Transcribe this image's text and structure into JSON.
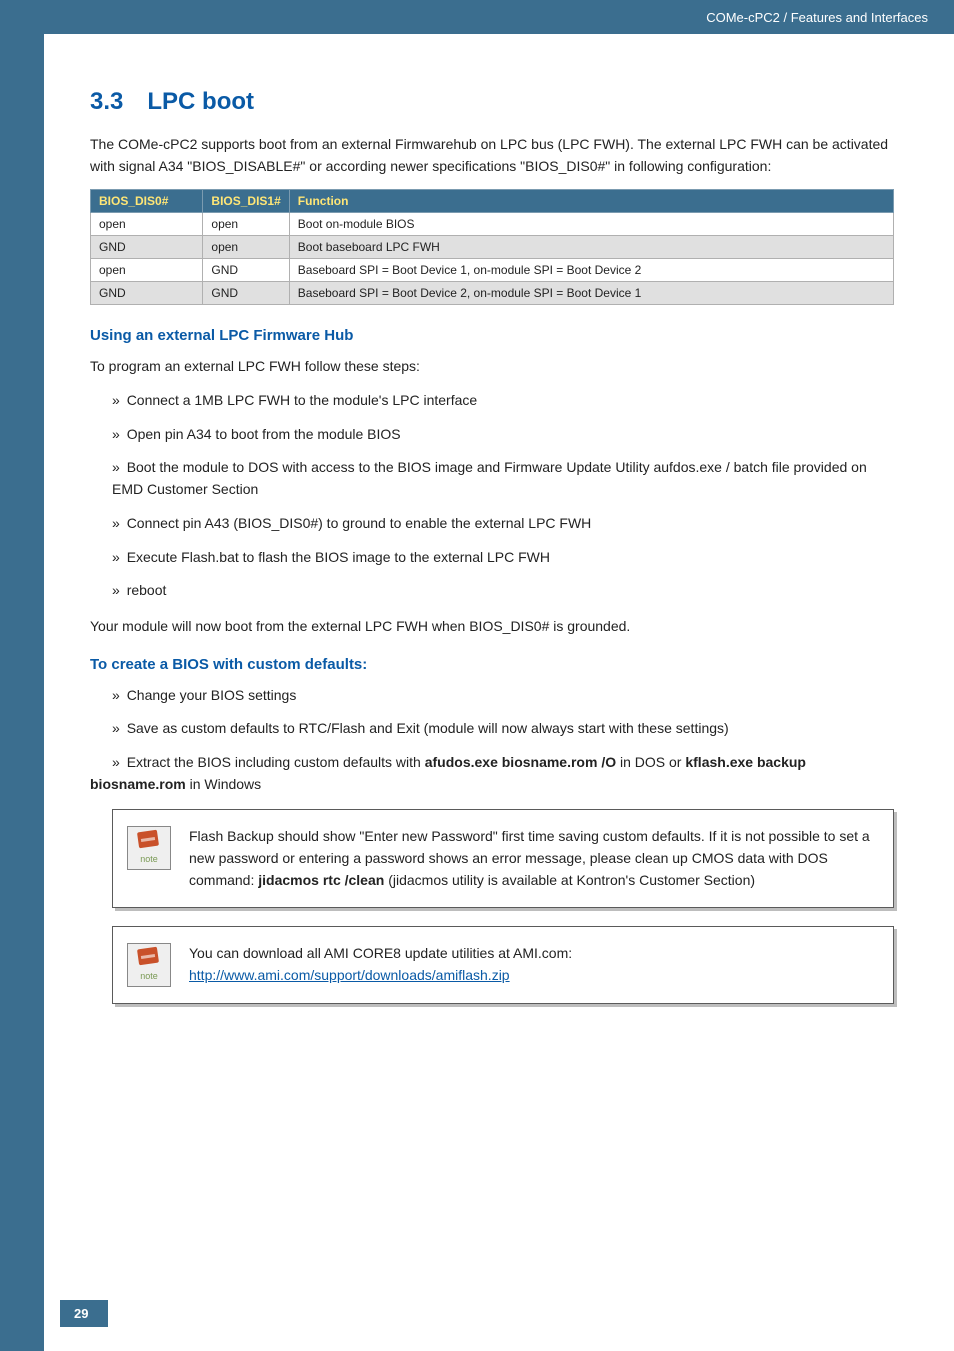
{
  "header": {
    "breadcrumb": "COMe-cPC2 / Features and Interfaces"
  },
  "section": {
    "number": "3.3",
    "title": "LPC boot"
  },
  "intro": "The COMe-cPC2 supports boot from an external Firmwarehub on LPC bus (LPC FWH). The external LPC FWH can be activated with signal A34 \"BIOS_DISABLE#\" or according newer specifications \"BIOS_DIS0#\" in following configuration:",
  "table": {
    "headers": [
      "BIOS_DIS0#",
      "BIOS_DIS1#",
      "Function"
    ],
    "rows": [
      [
        "open",
        "open",
        "Boot on-module BIOS"
      ],
      [
        "GND",
        "open",
        "Boot baseboard LPC FWH"
      ],
      [
        "open",
        "GND",
        "Baseboard SPI = Boot Device 1, on-module SPI = Boot Device 2"
      ],
      [
        "GND",
        "GND",
        "Baseboard SPI = Boot Device 2, on-module SPI = Boot Device 1"
      ]
    ]
  },
  "sub1": {
    "title": "Using an external LPC Firmware Hub",
    "lead": "To program an external LPC FWH follow these steps:",
    "items": [
      "Connect a 1MB LPC FWH to the module's LPC interface",
      "Open pin A34 to boot from the module BIOS",
      "Boot the module to DOS with access to the BIOS image and Firmware Update Utility aufdos.exe / batch file provided on EMD Customer Section",
      "Connect pin A43 (BIOS_DIS0#) to ground to enable the external LPC FWH",
      "Execute Flash.bat to flash the BIOS image to the external LPC FWH",
      "reboot"
    ],
    "trail": "Your module will now boot from the external LPC FWH when BIOS_DIS0# is grounded."
  },
  "sub2": {
    "title": "To create a BIOS with custom defaults:",
    "items": {
      "a": "Change your BIOS settings",
      "b": "Save as custom defaults to RTC/Flash and Exit (module will now always start with these settings)",
      "c_pre": "Extract the BIOS including custom defaults with ",
      "c_bold1": "afudos.exe biosname.rom /O",
      "c_mid": " in DOS or ",
      "c_bold2": "kflash.exe backup biosname.rom",
      "c_post": " in Windows"
    }
  },
  "note1": {
    "pre": "Flash Backup should show \"Enter new Password\" first time saving custom defaults. If it is not possible to set a new password or entering a password shows an error message, please clean up CMOS data with DOS command: ",
    "cmd": "jidacmos rtc /clean",
    "post": " (jidacmos utility is available at Kontron's Customer Section)",
    "icon_label": "note"
  },
  "note2": {
    "text": "You can download all AMI CORE8 update utilities at AMI.com:",
    "link": "http://www.ami.com/support/downloads/amiflash.zip",
    "icon_label": "note"
  },
  "page": "29"
}
